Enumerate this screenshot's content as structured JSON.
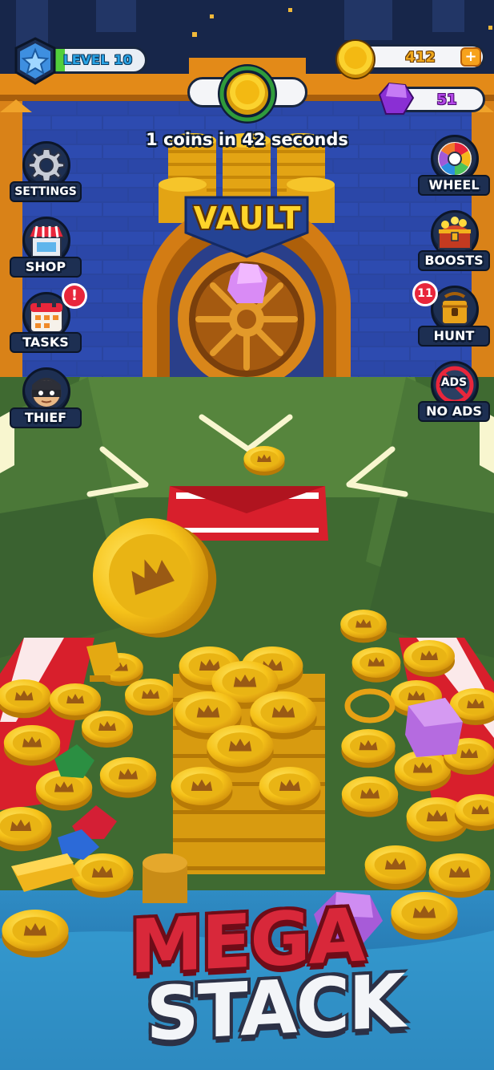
{
  "hud": {
    "level_label": "LEVEL 10",
    "level_progress": 0.35,
    "coins": "412",
    "coin_add": "+",
    "gems": "51",
    "timer_text": "1 coins in 42 seconds"
  },
  "left_menu": [
    {
      "label": "SETTINGS",
      "icon": "gear-icon"
    },
    {
      "label": "SHOP",
      "icon": "shop-icon"
    },
    {
      "label": "TASKS",
      "icon": "calendar-icon",
      "alert": "!"
    },
    {
      "label": "THIEF",
      "icon": "thief-icon"
    }
  ],
  "right_menu": [
    {
      "label": "WHEEL",
      "icon": "wheel-icon"
    },
    {
      "label": "BOOSTS",
      "icon": "treasure-chest-icon"
    },
    {
      "label": "HUNT",
      "icon": "treasure-hunt-icon",
      "badge": "11"
    },
    {
      "label": "NO ADS",
      "icon": "no-ads-icon",
      "icon_text": "ADS"
    }
  ],
  "vault": {
    "label": "VAULT"
  },
  "title": {
    "line1": "MEGA",
    "line2": "STACK"
  },
  "colors": {
    "wall": "#243a86",
    "board": "#4c7a3a",
    "gold": "#f5c518",
    "title_red": "#d8283a",
    "accent_orange": "#e8901c"
  }
}
